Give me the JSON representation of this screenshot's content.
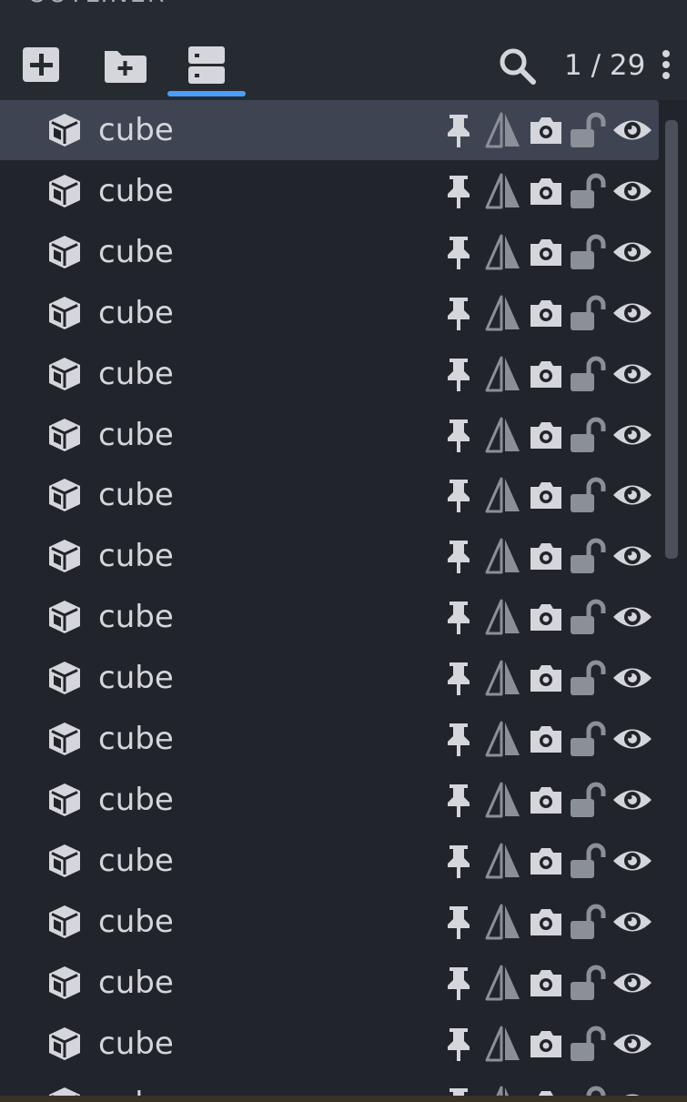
{
  "panel": {
    "title": "OUTLINER"
  },
  "toolbar": {
    "buttons": [
      {
        "icon": "add-icon"
      },
      {
        "icon": "add-folder-icon"
      },
      {
        "icon": "list-view-icon",
        "active": true
      }
    ],
    "search_icon": "search-icon",
    "page_counter": "1 / 29",
    "menu_icon": "kebab-menu-icon"
  },
  "colors": {
    "accent": "#4a9eff",
    "background": "#21252b",
    "selected_row": "#3e4451",
    "icon_light": "#d4d6dc",
    "icon_dim": "#8a8f98"
  },
  "items": [
    {
      "label": "cube",
      "icon": "cube-icon",
      "selected": true
    },
    {
      "label": "cube",
      "icon": "cube-icon"
    },
    {
      "label": "cube",
      "icon": "cube-icon"
    },
    {
      "label": "cube",
      "icon": "cube-icon"
    },
    {
      "label": "cube",
      "icon": "cube-icon"
    },
    {
      "label": "cube",
      "icon": "cube-icon"
    },
    {
      "label": "cube",
      "icon": "cube-icon"
    },
    {
      "label": "cube",
      "icon": "cube-icon"
    },
    {
      "label": "cube",
      "icon": "cube-icon"
    },
    {
      "label": "cube",
      "icon": "cube-icon"
    },
    {
      "label": "cube",
      "icon": "cube-icon"
    },
    {
      "label": "cube",
      "icon": "cube-icon"
    },
    {
      "label": "cube",
      "icon": "cube-icon"
    },
    {
      "label": "cube",
      "icon": "cube-icon"
    },
    {
      "label": "cube",
      "icon": "cube-icon"
    },
    {
      "label": "cube",
      "icon": "cube-icon"
    },
    {
      "label": "cube",
      "icon": "cube-icon"
    }
  ],
  "row_icons": [
    "pin-icon",
    "mirror-icon",
    "camera-icon",
    "unlocked-icon",
    "eye-icon"
  ]
}
